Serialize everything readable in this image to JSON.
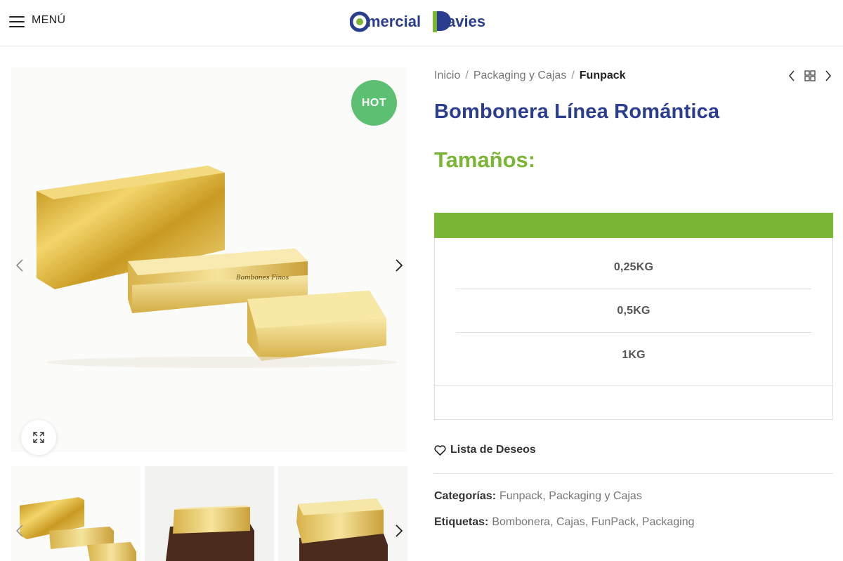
{
  "header": {
    "menu_label": "MENÚ",
    "logo_text_a": "mercial",
    "logo_text_b": "avies"
  },
  "gallery": {
    "badge": "HOT",
    "box_text": "Bombones Finos"
  },
  "breadcrumb": {
    "items": [
      "Inicio",
      "Packaging y Cajas"
    ],
    "current": "Funpack",
    "separator": "/"
  },
  "product": {
    "title": "Bombonera Línea Romántica",
    "sizes_heading": "Tamaños:",
    "sizes": [
      "0,25KG",
      "0,5KG",
      "1KG"
    ]
  },
  "wishlist": {
    "label": "Lista de Deseos"
  },
  "meta": {
    "categories_label": "Categorías:",
    "categories": [
      "Funpack",
      "Packaging y Cajas"
    ],
    "tags_label": "Etiquetas:",
    "tags": [
      "Bombonera",
      "Cajas",
      "FunPack",
      "Packaging"
    ]
  },
  "colors": {
    "brand_blue": "#2b3d8f",
    "brand_green": "#7ab536",
    "badge_green": "#5cbf72",
    "gold": "#d9b43a"
  }
}
